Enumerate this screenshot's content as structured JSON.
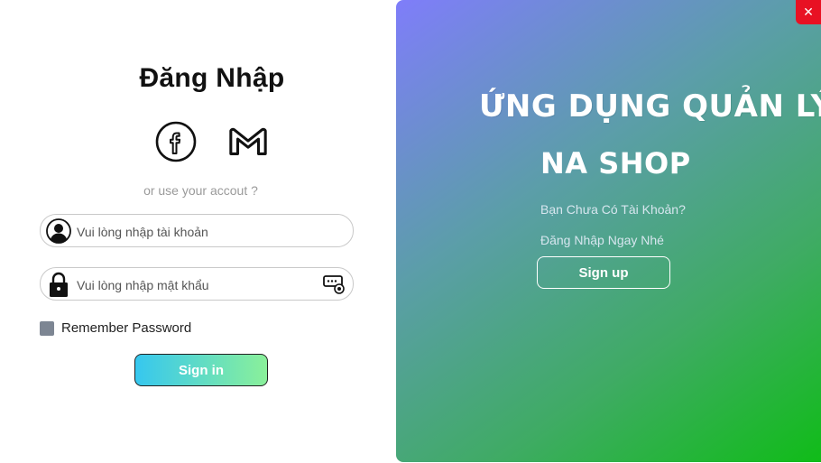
{
  "login": {
    "title": "Đăng Nhập",
    "social": [
      {
        "icon": "facebook-icon"
      },
      {
        "icon": "gmail-icon"
      }
    ],
    "subtitle": "or use your accout ?",
    "username_placeholder": "Vui lòng nhập tài khoản",
    "password_placeholder": "Vui lòng nhập mật khẩu",
    "remember_label": "Remember Password",
    "remember_checked": false,
    "signin_label": "Sign in"
  },
  "panel": {
    "brand_line1": "Ứng Dụng Quản Lý",
    "brand_line2": "NA Shop",
    "prompt_line1": "Bạn Chưa Có Tài Khoản?",
    "prompt_line2": "Đăng Nhập Ngay Nhé",
    "signup_label": "Sign up",
    "gradient_start": "#7f7dfa",
    "gradient_end": "#10bc18"
  },
  "window": {
    "close_glyph": "✕",
    "close_color": "#e81123"
  },
  "colors": {
    "signin_gradient_start": "#36c7ef",
    "signin_gradient_end": "#8af09a"
  }
}
